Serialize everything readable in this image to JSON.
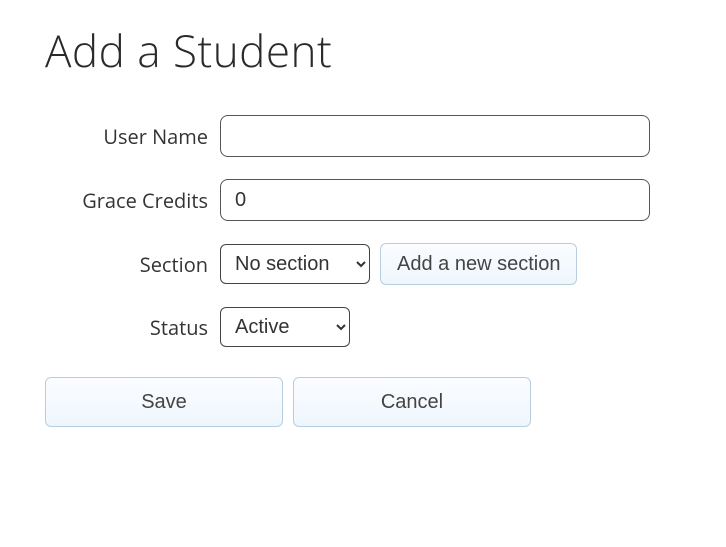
{
  "title": "Add a Student",
  "labels": {
    "username": "User Name",
    "grace_credits": "Grace Credits",
    "section": "Section",
    "status": "Status"
  },
  "fields": {
    "username": "",
    "grace_credits": "0",
    "section_selected": "No section",
    "status_selected": "Active"
  },
  "buttons": {
    "add_section": "Add a new section",
    "save": "Save",
    "cancel": "Cancel"
  }
}
